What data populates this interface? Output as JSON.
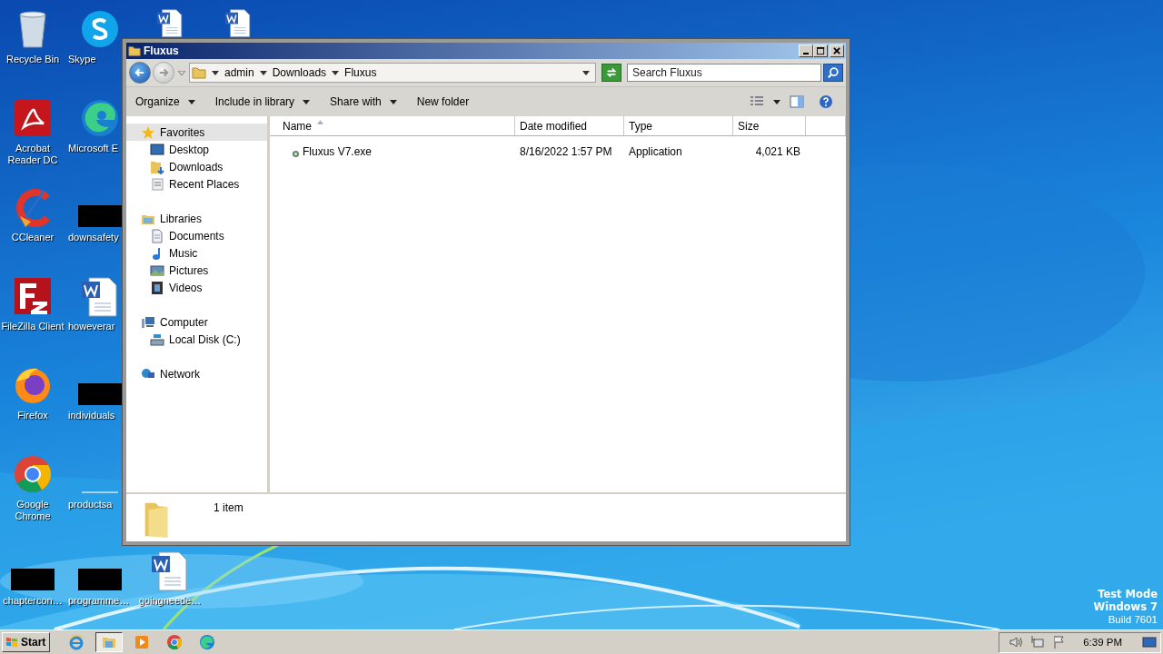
{
  "desktop": {
    "icons": [
      {
        "label": "Recycle Bin",
        "kind": "recycle"
      },
      {
        "label": "Acrobat Reader DC",
        "kind": "acrobat"
      },
      {
        "label": "CCleaner",
        "kind": "ccleaner"
      },
      {
        "label": "FileZilla Client",
        "kind": "filezilla"
      },
      {
        "label": "Firefox",
        "kind": "firefox"
      },
      {
        "label": "Google Chrome",
        "kind": "chrome"
      },
      {
        "label": "chaptercon…",
        "kind": "redacted"
      },
      {
        "label": "Skype",
        "kind": "skype"
      },
      {
        "label": "Microsoft E",
        "kind": "edge"
      },
      {
        "label": "downsafety",
        "kind": "redacted"
      },
      {
        "label": "howeverar",
        "kind": "word"
      },
      {
        "label": "individuals",
        "kind": "redacted"
      },
      {
        "label": "productsa",
        "kind": "blank"
      },
      {
        "label": "programme…",
        "kind": "redacted"
      },
      {
        "kind": "word"
      },
      {
        "label": "goingneede…",
        "kind": "word"
      },
      {
        "kind": "word"
      }
    ],
    "os_notice": [
      "Test Mode",
      "Windows 7",
      "Build 7601"
    ]
  },
  "window": {
    "title": "Fluxus",
    "breadcrumb": [
      "admin",
      "Downloads",
      "Fluxus"
    ],
    "search": {
      "placeholder": "Search Fluxus"
    },
    "toolbar": [
      {
        "label": "Organize",
        "dropdown": true
      },
      {
        "label": "Include in library",
        "dropdown": true
      },
      {
        "label": "Share with",
        "dropdown": true
      },
      {
        "label": "New folder",
        "dropdown": false
      }
    ],
    "nav": [
      {
        "label": "Favorites",
        "kind": "star",
        "selected": true,
        "children": [
          {
            "label": "Desktop",
            "kind": "desktop",
            "selected": false
          },
          {
            "label": "Downloads",
            "kind": "downloads",
            "selected": false
          },
          {
            "label": "Recent Places",
            "kind": "recent",
            "selected": false
          }
        ]
      },
      {
        "label": "Libraries",
        "kind": "libraries",
        "selected": false,
        "children": [
          {
            "label": "Documents",
            "kind": "documents",
            "selected": false
          },
          {
            "label": "Music",
            "kind": "music",
            "selected": false
          },
          {
            "label": "Pictures",
            "kind": "pictures",
            "selected": false
          },
          {
            "label": "Videos",
            "kind": "videos",
            "selected": false
          }
        ]
      },
      {
        "label": "Computer",
        "kind": "computer",
        "selected": false,
        "children": [
          {
            "label": "Local Disk (C:)",
            "kind": "disk",
            "selected": false
          }
        ]
      },
      {
        "label": "Network",
        "kind": "network",
        "selected": false
      }
    ],
    "columns": [
      {
        "label": "Name",
        "sorted": true
      },
      {
        "label": "Date modified",
        "sorted": false
      },
      {
        "label": "Type",
        "sorted": false
      },
      {
        "label": "Size",
        "sorted": false
      }
    ],
    "rows": [
      {
        "name": "Fluxus V7.exe",
        "date_modified": "8/16/2022 1:57 PM",
        "type": "Application",
        "size": "4,021 KB"
      }
    ],
    "status": "1 item"
  },
  "taskbar": {
    "start": "Start",
    "apps": [
      {
        "kind": "ie",
        "selected": false
      },
      {
        "kind": "explorer",
        "selected": true
      },
      {
        "kind": "media",
        "selected": false
      },
      {
        "kind": "chrome",
        "selected": false
      },
      {
        "kind": "edge",
        "selected": false
      }
    ],
    "clock": "6:39 PM"
  }
}
